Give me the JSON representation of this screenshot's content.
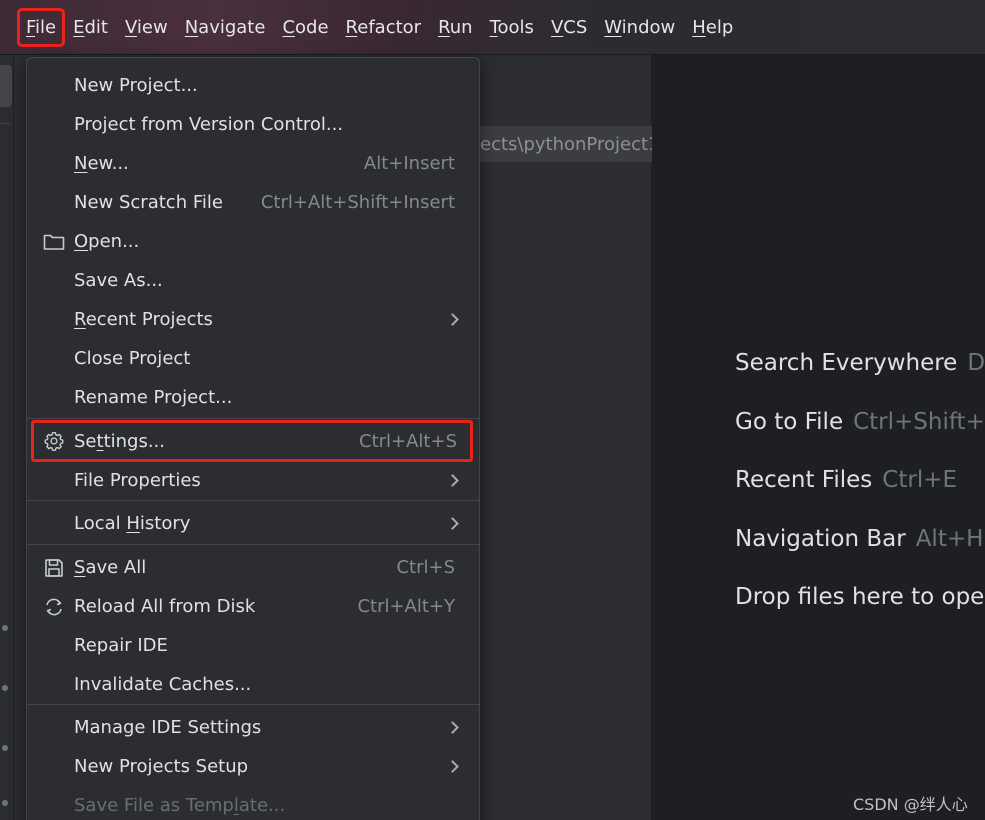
{
  "menubar": {
    "items": [
      {
        "label": "File",
        "mnemonic": "F",
        "rest": "ile"
      },
      {
        "label": "Edit",
        "mnemonic": "E",
        "rest": "dit"
      },
      {
        "label": "View",
        "mnemonic": "V",
        "rest": "iew"
      },
      {
        "label": "Navigate",
        "mnemonic": "N",
        "rest": "avigate"
      },
      {
        "label": "Code",
        "mnemonic": "C",
        "rest": "ode"
      },
      {
        "label": "Refactor",
        "mnemonic": "R",
        "rest": "efactor"
      },
      {
        "label": "Run",
        "mnemonic": "R",
        "rest": "un"
      },
      {
        "label": "Tools",
        "mnemonic": "T",
        "rest": "ools"
      },
      {
        "label": "VCS",
        "mnemonic": "V",
        "rest": "CS"
      },
      {
        "label": "Window",
        "mnemonic": "W",
        "rest": "indow"
      },
      {
        "label": "Help",
        "mnemonic": "H",
        "rest": "elp"
      }
    ]
  },
  "project_panel": {
    "path_fragment": "ects\\pythonProject1"
  },
  "file_menu": {
    "items": [
      {
        "label": "New Project...",
        "shortcut": ""
      },
      {
        "label": "Project from Version Control...",
        "shortcut": ""
      },
      {
        "label_pre": "",
        "label_u": "N",
        "label_post": "ew...",
        "shortcut": "Alt+Insert"
      },
      {
        "label": "New Scratch File",
        "shortcut": "Ctrl+Alt+Shift+Insert"
      },
      {
        "label_pre": "",
        "label_u": "O",
        "label_post": "pen...",
        "shortcut": "",
        "icon": "folder-icon"
      },
      {
        "label": "Save As...",
        "shortcut": ""
      },
      {
        "label_pre": "",
        "label_u": "R",
        "label_post": "ecent Projects",
        "shortcut": "",
        "submenu": true
      },
      {
        "label": "Close Project",
        "shortcut": ""
      },
      {
        "label": "Rename Project...",
        "shortcut": ""
      },
      {
        "label_pre": "Se",
        "label_u": "t",
        "label_post": "tings...",
        "shortcut": "Ctrl+Alt+S",
        "icon": "gear-icon"
      },
      {
        "label": "File Properties",
        "shortcut": "",
        "submenu": true
      },
      {
        "label_pre": "Local ",
        "label_u": "H",
        "label_post": "istory",
        "shortcut": "",
        "submenu": true
      },
      {
        "label_pre": "",
        "label_u": "S",
        "label_post": "ave All",
        "shortcut": "Ctrl+S",
        "icon": "save-icon"
      },
      {
        "label": "Reload All from Disk",
        "shortcut": "Ctrl+Alt+Y",
        "icon": "reload-icon"
      },
      {
        "label": "Repair IDE",
        "shortcut": ""
      },
      {
        "label": "Invalidate Caches...",
        "shortcut": ""
      },
      {
        "label": "Manage IDE Settings",
        "shortcut": "",
        "submenu": true
      },
      {
        "label": "New Projects Setup",
        "shortcut": "",
        "submenu": true
      },
      {
        "label_pre": "Save File as Temp",
        "label_u": "l",
        "label_post": "ate...",
        "shortcut": "",
        "disabled": true
      }
    ]
  },
  "welcome": {
    "hints": [
      {
        "label": "Search Everywhere",
        "key": "Do"
      },
      {
        "label": "Go to File",
        "key": "Ctrl+Shift+"
      },
      {
        "label": "Recent Files",
        "key": "Ctrl+E"
      },
      {
        "label": "Navigation Bar",
        "key": "Alt+H"
      },
      {
        "label": "Drop files here to ope",
        "key": ""
      }
    ]
  },
  "watermark": "CSDN @绊人心",
  "colors": {
    "highlight": "#e8231c",
    "menu_bg": "#2b2d30",
    "editor_bg": "#1e1f22"
  }
}
